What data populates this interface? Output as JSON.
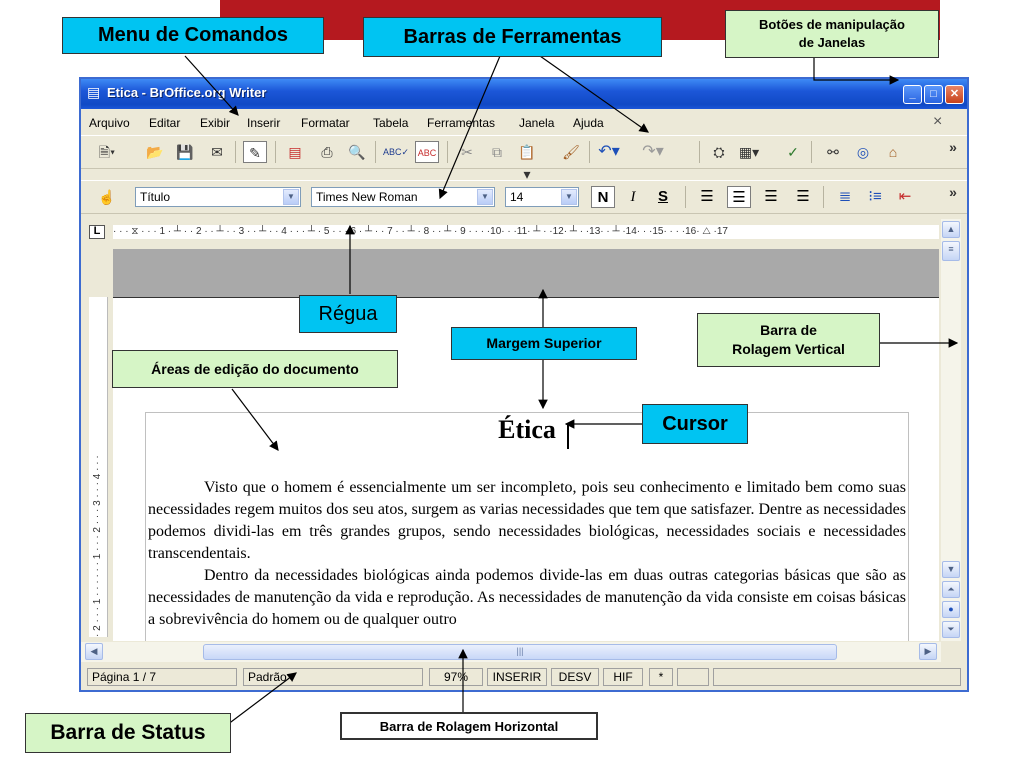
{
  "window": {
    "title": "Etica - BrOffice.org Writer",
    "buttons": {
      "minimize": "_",
      "maximize": "□",
      "close": "✕"
    }
  },
  "menu": {
    "items": [
      "Arquivo",
      "Editar",
      "Exibir",
      "Inserir",
      "Formatar",
      "Tabela",
      "Ferramentas",
      "Janela",
      "Ajuda"
    ],
    "doc_close": "×"
  },
  "toolbar_standard": {
    "icons": [
      "new-doc-icon",
      "open-folder-icon",
      "save-disk-icon",
      "email-icon",
      "edit-file-icon",
      "pdf-export-icon",
      "print-icon",
      "page-preview-icon",
      "spellcheck-icon",
      "autospell-icon",
      "cut-icon",
      "copy-icon",
      "paste-icon",
      "format-paintbrush-icon",
      "undo-icon",
      "redo-icon",
      "navigator-icon",
      "table-icon",
      "draw-functions-icon",
      "find-binoculars-icon",
      "compass-icon",
      "gallery-icon"
    ],
    "more": "»"
  },
  "toolbar_format": {
    "style_value": "Título",
    "font_value": "Times New Roman",
    "size_value": "14",
    "bold": "N",
    "italic": "I",
    "underline": "S",
    "more": "»"
  },
  "ruler": {
    "text": "· · · ⧖ · · · 1 · ┴ · · 2 · · ┴ · · 3 · · ┴ · · 4 · · · ┴ · 5 · · · 6 · ┴ · · 7 · · ┴ · 8 · · ┴ · 9 · · · ·10· · ·11· ┴ · ·12· ┴ · ·13· · ┴ ·14· · ·15· · · ·16· △ ·17",
    "vertical": "· 2 · · · 1 · · · · · · 1 · · · 2 · · · 3 · · · 4 · · ·"
  },
  "document": {
    "title": "Ética",
    "para1": "Visto que o homem é essencialmente um ser incompleto, pois seu conhecimento e limitado bem como suas necessidades regem muitos dos seu atos, surgem as varias necessidades que tem que satisfazer. Dentre as necessidades podemos dividi-las em três grandes grupos, sendo necessidades biológicas, necessidades sociais e necessidades transcendentais.",
    "para2": "Dentro da necessidades biológicas ainda podemos divide-las em duas outras categorias básicas que são as necessidades de manutenção da vida e reprodução. As necessidades de manutenção da vida consiste em coisas básicas a sobrevivência do homem ou de qualquer outro"
  },
  "statusbar": {
    "page": "Página 1 / 7",
    "style": "Padrão",
    "zoom": "97%",
    "insert": "INSERIR",
    "selection": "DESV",
    "hyperlink": "HIF",
    "modified": "*"
  },
  "callouts": {
    "menu_comandos": "Menu de Comandos",
    "barras_ferramentas": "Barras de Ferramentas",
    "botoes_janelas_1": "Botões de manipulação",
    "botoes_janelas_2": "de Janelas",
    "regua": "Régua",
    "margem_superior": "Margem Superior",
    "barra_vertical_1": "Barra de",
    "barra_vertical_2": "Rolagem Vertical",
    "areas_edicao": "Áreas de edição do documento",
    "cursor": "Cursor",
    "barra_status": "Barra de Status",
    "barra_horizontal": "Barra de Rolagem Horizontal"
  },
  "colors": {
    "titlebar": "#1c57d8",
    "callout_cyan": "#00c4f2",
    "callout_green": "#d6f5c6",
    "red_band": "#b5191f"
  }
}
